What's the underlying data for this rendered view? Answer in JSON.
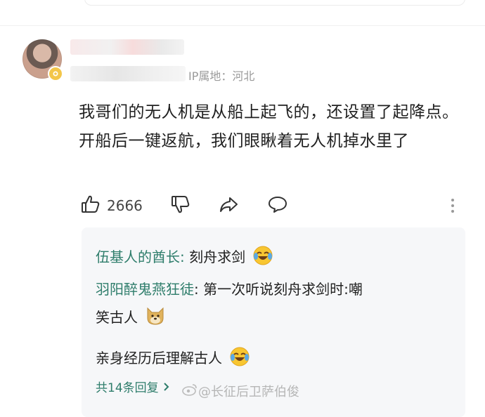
{
  "comment": {
    "ip_location": "IP属地：河北",
    "text": "我哥们的无人机是从船上起飞的，还设置了起降点。开船后一键返航，我们眼瞅着无人机掉水里了",
    "like_count": "2666"
  },
  "replies": [
    {
      "user": "伍基人的酋长",
      "sep": ": ",
      "text": "刻舟求剑",
      "emoji": "crying-laugh-emoji"
    },
    {
      "user": "羽阳醉鬼燕狂徒",
      "sep": ": ",
      "text": "第一次听说刻舟求剑时:嘲",
      "cont": "笑古人",
      "emoji": "doge-emoji"
    },
    {
      "text": "亲身经历后理解古人",
      "emoji": "crying-laugh-emoji"
    }
  ],
  "reply_count_label": "共14条回复",
  "watermark": "@长征后卫萨伯俊",
  "colors": {
    "username": "#2e7d6b",
    "ip_text": "#9a9a9a",
    "reply_bg": "#f6f7f9"
  },
  "icons": [
    "thumbs-up-icon",
    "thumbs-down-icon",
    "share-icon",
    "comment-icon",
    "more-icon",
    "chevron-right-icon",
    "weibo-logo-icon"
  ]
}
